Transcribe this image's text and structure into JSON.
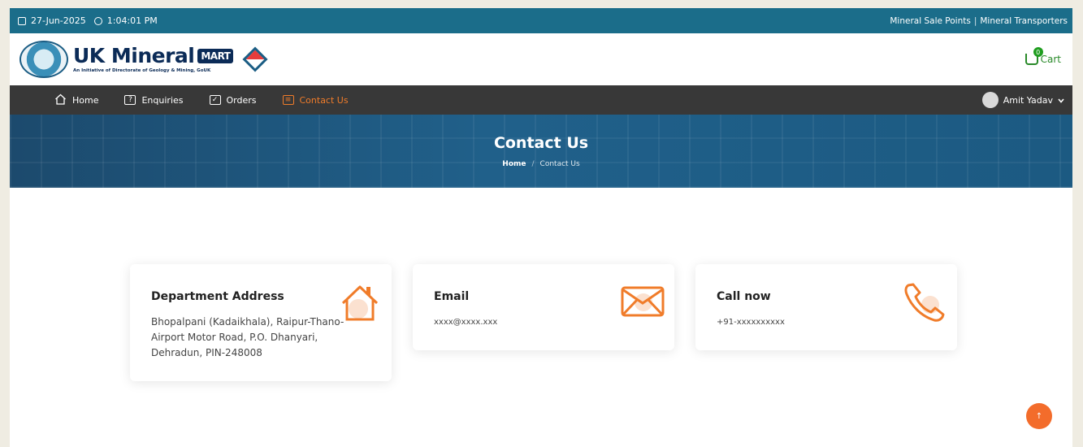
{
  "topbar": {
    "date": "27-Jun-2025",
    "time": "1:04:01 PM",
    "links": [
      "Mineral Sale Points",
      "Mineral Transporters"
    ]
  },
  "header": {
    "brand_title": "UK Mineral",
    "brand_mart": "MART",
    "brand_subtitle": "An Initiative of Directorate of Geology & Mining, GoUK",
    "cart_label": "Cart",
    "cart_count": "0"
  },
  "nav": {
    "items": [
      {
        "label": "Home",
        "icon": "home-icon"
      },
      {
        "label": "Enquiries",
        "icon": "question-icon"
      },
      {
        "label": "Orders",
        "icon": "orders-icon"
      },
      {
        "label": "Contact Us",
        "icon": "contact-icon"
      }
    ],
    "active": "Contact Us",
    "user_name": "Amit Yadav"
  },
  "hero": {
    "title": "Contact Us",
    "breadcrumb_home": "Home",
    "breadcrumb_sep": "/",
    "breadcrumb_current": "Contact Us"
  },
  "cards": {
    "address": {
      "title": "Department Address",
      "text": "Bhopalpani (Kadaikhala), Raipur-Thano- Airport Motor Road, P.O. Dhanyari, Dehradun, PIN-248008",
      "icon": "house-icon"
    },
    "email": {
      "title": "Email",
      "text": "xxxx@xxxx.xxx",
      "icon": "envelope-icon"
    },
    "phone": {
      "title": "Call now",
      "text": "+91-xxxxxxxxxx",
      "icon": "phone-icon"
    }
  },
  "colors": {
    "topbar": "#1b6d8a",
    "nav": "#383838",
    "accent": "#f07c2a",
    "brand": "#0b2b57"
  }
}
